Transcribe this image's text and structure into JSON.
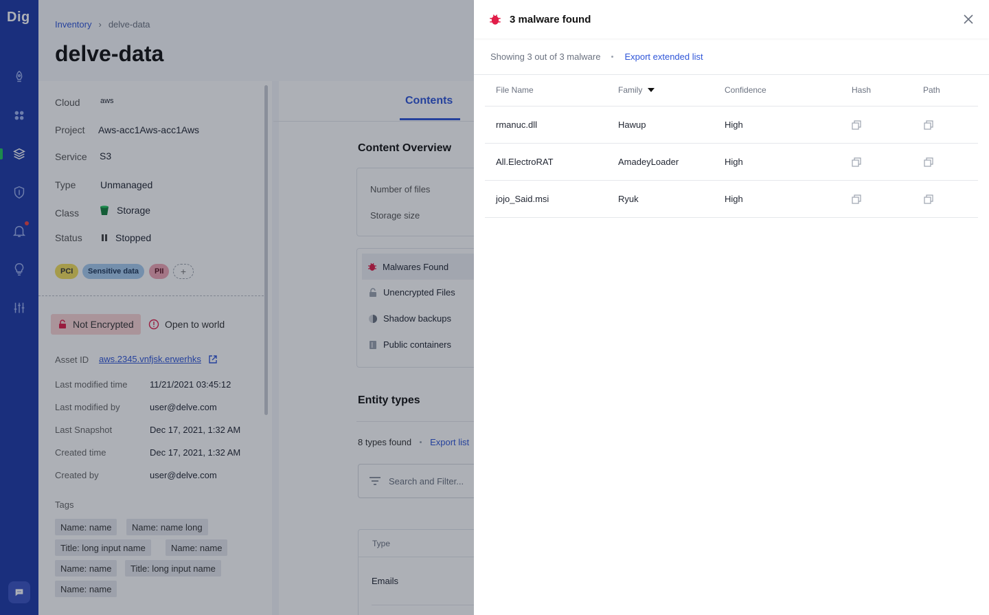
{
  "app": {
    "logo": "Dig"
  },
  "breadcrumb": {
    "parent": "Inventory",
    "current": "delve-data"
  },
  "page": {
    "title": "delve-data"
  },
  "properties": [
    {
      "label": "Cloud",
      "value": "aws"
    },
    {
      "label": "Project",
      "value": "Aws-acc1Aws-acc1Aws"
    },
    {
      "label": "Service",
      "value": "S3"
    },
    {
      "label": "Type",
      "value": "Unmanaged"
    },
    {
      "label": "Class",
      "value": "Storage"
    },
    {
      "label": "Status",
      "value": "Stopped"
    }
  ],
  "chips": {
    "pci": "PCI",
    "sensitive": "Sensitive data",
    "pii": "PII",
    "add": "+"
  },
  "security": {
    "not_encrypted": "Not Encrypted",
    "open_to_world": "Open to world"
  },
  "meta": [
    {
      "label": "Asset ID",
      "value": "aws.2345.vnfjsk.erwerhks"
    },
    {
      "label": "Last modified time",
      "value": "11/21/2021 03:45:12"
    },
    {
      "label": "Last modified by",
      "value": "user@delve.com"
    },
    {
      "label": "Last Snapshot",
      "value": "Dec 17, 2021, 1:32 AM"
    },
    {
      "label": "Created time",
      "value": "Dec 17, 2021, 1:32 AM"
    },
    {
      "label": "Created  by",
      "value": "user@delve.com"
    }
  ],
  "tags": {
    "label": "Tags",
    "items": [
      "Name: name",
      "Name: name long",
      "Title: long input name",
      "Name: name",
      "Name: name",
      "Title: long input name",
      "Name: name"
    ]
  },
  "contents": {
    "tab": "Contents",
    "overview_title": "Content Overview",
    "number_of_files": "Number of files",
    "storage_size": "Storage size",
    "findings": [
      "Malwares Found",
      "Unencrypted Files",
      "Shadow backups",
      "Public containers"
    ],
    "entity_title": "Entity types",
    "types_found": "8 types found",
    "export_list": "Export list",
    "search_placeholder": "Search and Filter...",
    "table_type_header": "Type",
    "table_first_row": "Emails"
  },
  "drawer": {
    "title": "3 malware found",
    "showing": "Showing 3 out of 3 malware",
    "export": "Export extended list",
    "columns": {
      "file_name": "File Name",
      "family": "Family",
      "confidence": "Confidence",
      "hash": "Hash",
      "path": "Path"
    },
    "rows": [
      {
        "file": "rmanuc.dll",
        "family": "Hawup",
        "confidence": "High"
      },
      {
        "file": "All.ElectroRAT",
        "family": "AmadeyLoader",
        "confidence": "High"
      },
      {
        "file": "jojo_Said.msi",
        "family": "Ryuk",
        "confidence": "High"
      }
    ]
  },
  "colors": {
    "sidebar": "#1e3aa8",
    "accent": "#2e55d8",
    "danger": "#e11d48"
  }
}
